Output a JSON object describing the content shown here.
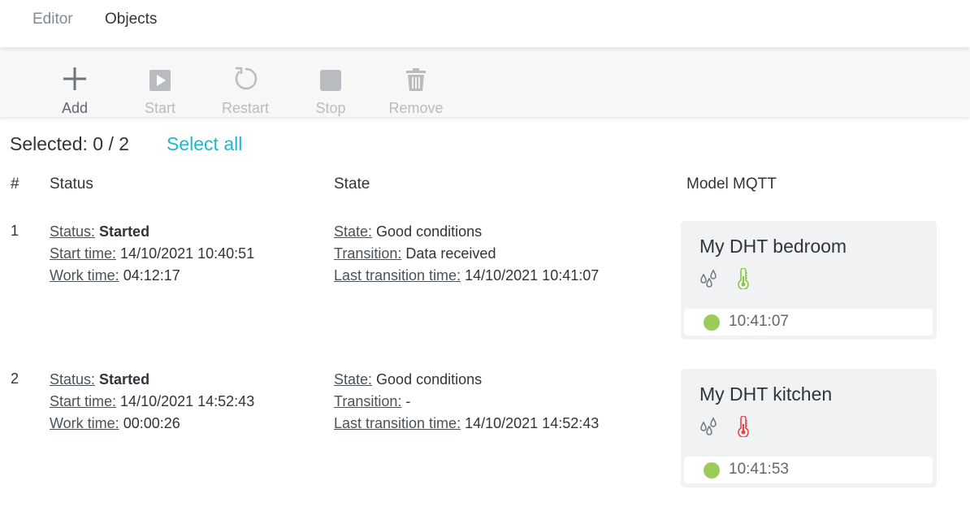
{
  "nav": {
    "tabs": [
      {
        "label": "Editor"
      },
      {
        "label": "Objects"
      }
    ]
  },
  "toolbar": {
    "add": {
      "label": "Add",
      "icon": "plus-icon",
      "enabled": true
    },
    "start": {
      "label": "Start",
      "icon": "play-icon",
      "enabled": false
    },
    "restart": {
      "label": "Restart",
      "icon": "restart-icon",
      "enabled": false
    },
    "stop": {
      "label": "Stop",
      "icon": "stop-icon",
      "enabled": false
    },
    "remove": {
      "label": "Remove",
      "icon": "trash-icon",
      "enabled": false
    }
  },
  "selection": {
    "text": "Selected: 0 / 2",
    "select_all": "Select all"
  },
  "table": {
    "headers": {
      "num": "#",
      "status": "Status",
      "state": "State",
      "model": "Model MQTT"
    },
    "rows": [
      {
        "num": "1",
        "status_key": "Status:",
        "status_value": "Started",
        "start_key": "Start time:",
        "start_value": "14/10/2021 10:40:51",
        "work_key": "Work time:",
        "work_value": "04:12:17",
        "state_key": "State:",
        "state_value": "Good conditions",
        "transition_key": "Transition:",
        "transition_value": "Data received",
        "last_key": "Last transition time:",
        "last_value": "14/10/2021 10:41:07",
        "card": {
          "title": "My DHT bedroom",
          "humidity_icon": "droplets-icon",
          "temp_icon": "thermometer-icon",
          "temp_color": "#8cc63f",
          "status_color": "#9bcc5b",
          "time": "10:41:07"
        }
      },
      {
        "num": "2",
        "status_key": "Status:",
        "status_value": "Started",
        "start_key": "Start time:",
        "start_value": "14/10/2021 14:52:43",
        "work_key": "Work time:",
        "work_value": "00:00:26",
        "state_key": "State:",
        "state_value": "Good conditions",
        "transition_key": "Transition:",
        "transition_value": "-",
        "last_key": "Last transition time:",
        "last_value": "14/10/2021 14:52:43",
        "card": {
          "title": "My DHT kitchen",
          "humidity_icon": "droplets-icon",
          "temp_icon": "thermometer-icon",
          "temp_color": "#e8434a",
          "status_color": "#9bcc5b",
          "time": "10:41:53"
        }
      }
    ]
  },
  "colors": {
    "accent": "#1eb9cf",
    "disabled": "#b8bcc0",
    "icon_gray": "#6c757d"
  }
}
